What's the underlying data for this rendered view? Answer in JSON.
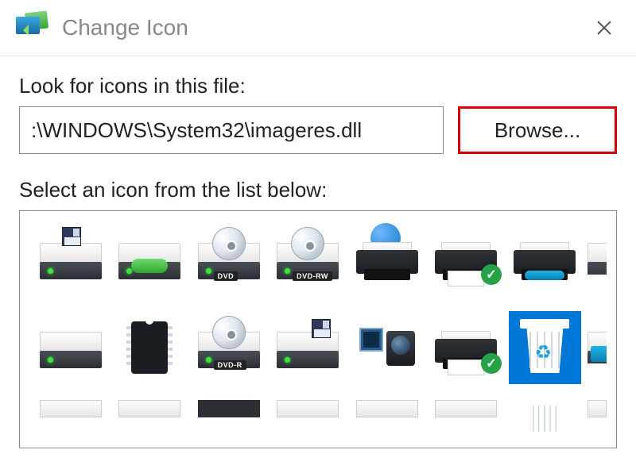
{
  "titlebar": {
    "title": "Change Icon",
    "app_icon": "change-icon-app",
    "close": "×"
  },
  "labels": {
    "look_for": "Look for icons in this file:",
    "select_below": "Select an icon from the list below:"
  },
  "filepath": ":\\WINDOWS\\System32\\imageres.dll",
  "browse_label": "Browse...",
  "badges": {
    "dvd": "DVD",
    "dvdrw": "DVD-RW",
    "dvdr": "DVD-R"
  },
  "icons": {
    "row1": [
      "floppy-drive",
      "hard-drive",
      "dvd-drive",
      "dvd-rw-drive",
      "network-printer",
      "printer-default",
      "printer-remote",
      "external-drive-partial"
    ],
    "row2": [
      "hard-drive",
      "chip",
      "dvd-r-drive",
      "hard-drive-floppy",
      "camcorder",
      "printer-default",
      "recycle-bin-full",
      "external-drive-partial"
    ],
    "selected": "recycle-bin-full"
  }
}
